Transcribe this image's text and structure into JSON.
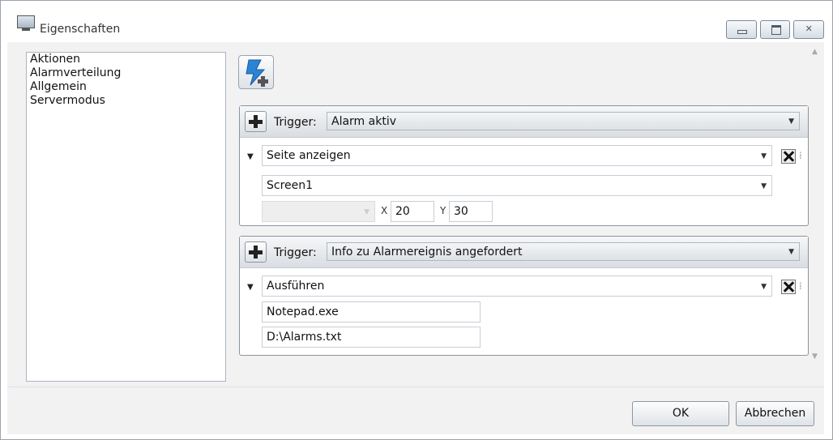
{
  "window": {
    "title": "Eigenschaften",
    "icon": "properties-window-icon"
  },
  "nav": {
    "items": [
      "Aktionen",
      "Alarmverteilung",
      "Allgemein",
      "Servermodus"
    ]
  },
  "toolbar": {
    "add_action_icon": "lightning-add-icon"
  },
  "trigger_label": "Trigger:",
  "groups": [
    {
      "trigger": "Alarm aktiv",
      "action": "Seite anzeigen",
      "page": "Screen1",
      "x_label": "X",
      "x_value": "20",
      "y_label": "Y",
      "y_value": "30"
    },
    {
      "trigger": "Info zu Alarmereignis angefordert",
      "action": "Ausführen",
      "program": "Notepad.exe",
      "argument": "D:\\Alarms.txt"
    }
  ],
  "buttons": {
    "ok": "OK",
    "cancel": "Abbrechen"
  }
}
